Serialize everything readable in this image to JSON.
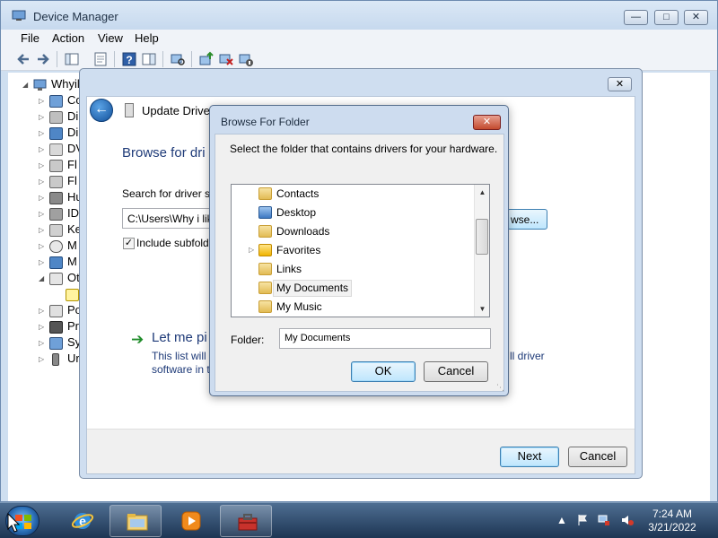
{
  "device_manager": {
    "title": "Device Manager",
    "menu": [
      "File",
      "Action",
      "View",
      "Help"
    ],
    "tree": {
      "root": "Whyil",
      "items": [
        "Co",
        "Di",
        "Di",
        "DV",
        "Fl",
        "Fl",
        "Hu",
        "ID",
        "Ke",
        "M",
        "M",
        "Ot",
        "",
        "Po",
        "Pr",
        "Sy",
        "Ur"
      ]
    }
  },
  "wizard": {
    "title": "Update Driver So",
    "heading": "Browse for dri",
    "search_label": "Search for driver so",
    "path_value": "C:\\Users\\Why i like",
    "browse_label": "wse...",
    "include_label": "Include subfold",
    "letme_title": "Let me pi",
    "desc_line1": "This list will s",
    "desc_line1_tail": "ll driver",
    "desc_line2": "software in t",
    "next_label": "Next",
    "cancel_label": "Cancel"
  },
  "browse_dialog": {
    "title": "Browse For Folder",
    "instructions": "Select the folder that contains drivers for your hardware.",
    "folders": [
      {
        "name": "Contacts",
        "expandable": false,
        "selected": false
      },
      {
        "name": "Desktop",
        "expandable": false,
        "selected": false
      },
      {
        "name": "Downloads",
        "expandable": false,
        "selected": false
      },
      {
        "name": "Favorites",
        "expandable": true,
        "selected": false
      },
      {
        "name": "Links",
        "expandable": false,
        "selected": false
      },
      {
        "name": "My Documents",
        "expandable": false,
        "selected": true
      },
      {
        "name": "My Music",
        "expandable": false,
        "selected": false
      }
    ],
    "folder_label": "Folder:",
    "folder_value": "My Documents",
    "ok_label": "OK",
    "cancel_label": "Cancel"
  },
  "taskbar": {
    "time": "7:24 AM",
    "date": "3/21/2022",
    "apps": [
      "internet-explorer-icon",
      "windows-explorer-icon",
      "media-player-icon",
      "device-manager-toolbox-icon"
    ]
  },
  "colors": {
    "accent_blue": "#1e3a78",
    "taskbar": "#1d3553",
    "selection": "#f2f2f2"
  }
}
